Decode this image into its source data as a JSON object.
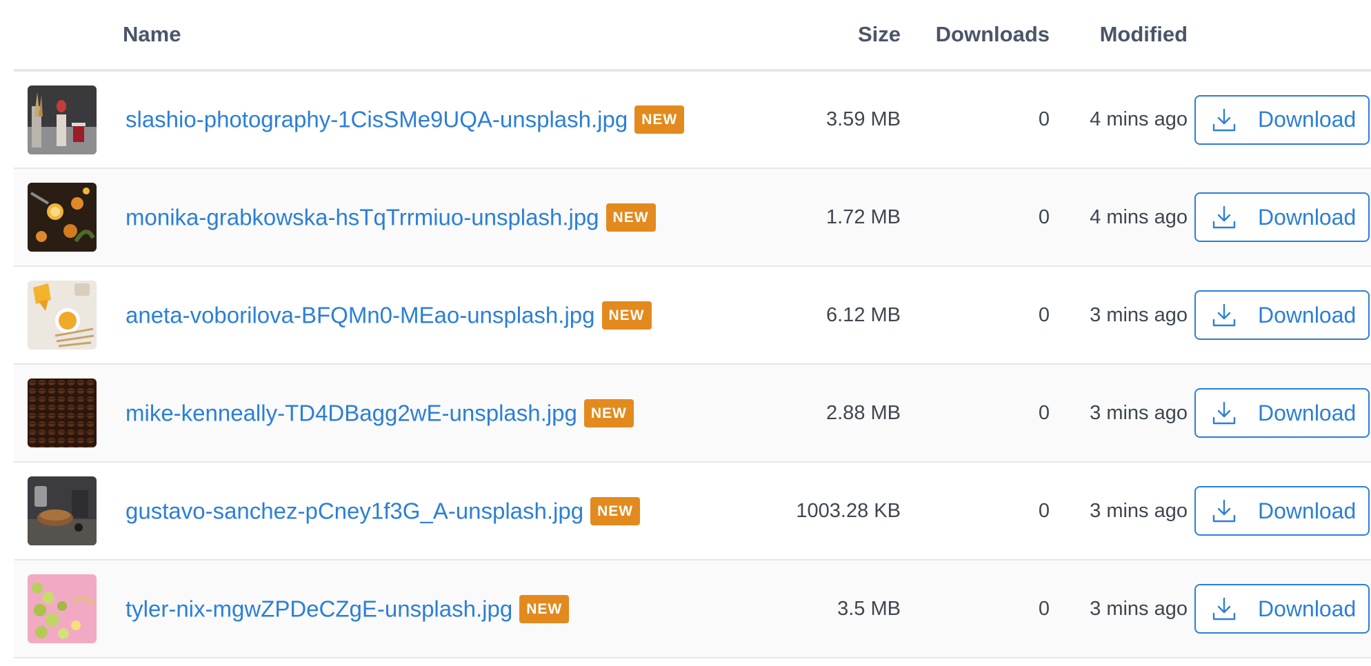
{
  "table": {
    "headers": {
      "name": "Name",
      "size": "Size",
      "downloads": "Downloads",
      "modified": "Modified"
    },
    "download_label": "Download",
    "badge_label": "NEW",
    "files": [
      {
        "name": "slashio-photography-1CisSMe9UQA-unsplash.jpg",
        "size": "3.59 MB",
        "downloads": "0",
        "modified": "4 mins ago"
      },
      {
        "name": "monika-grabkowska-hsTqTrrmiuo-unsplash.jpg",
        "size": "1.72 MB",
        "downloads": "0",
        "modified": "4 mins ago"
      },
      {
        "name": "aneta-voborilova-BFQMn0-MEao-unsplash.jpg",
        "size": "6.12 MB",
        "downloads": "0",
        "modified": "3 mins ago"
      },
      {
        "name": "mike-kenneally-TD4DBagg2wE-unsplash.jpg",
        "size": "2.88 MB",
        "downloads": "0",
        "modified": "3 mins ago"
      },
      {
        "name": "gustavo-sanchez-pCney1f3G_A-unsplash.jpg",
        "size": "1003.28 KB",
        "downloads": "0",
        "modified": "3 mins ago"
      },
      {
        "name": "tyler-nix-mgwZPDeCZgE-unsplash.jpg",
        "size": "3.5 MB",
        "downloads": "0",
        "modified": "3 mins ago"
      }
    ]
  },
  "colors": {
    "link": "#2b7fd6",
    "badge": "#e38a1e",
    "header_text": "#4a5568",
    "border": "#e5e7eb"
  },
  "icons": {
    "download": "download-tray-icon"
  }
}
